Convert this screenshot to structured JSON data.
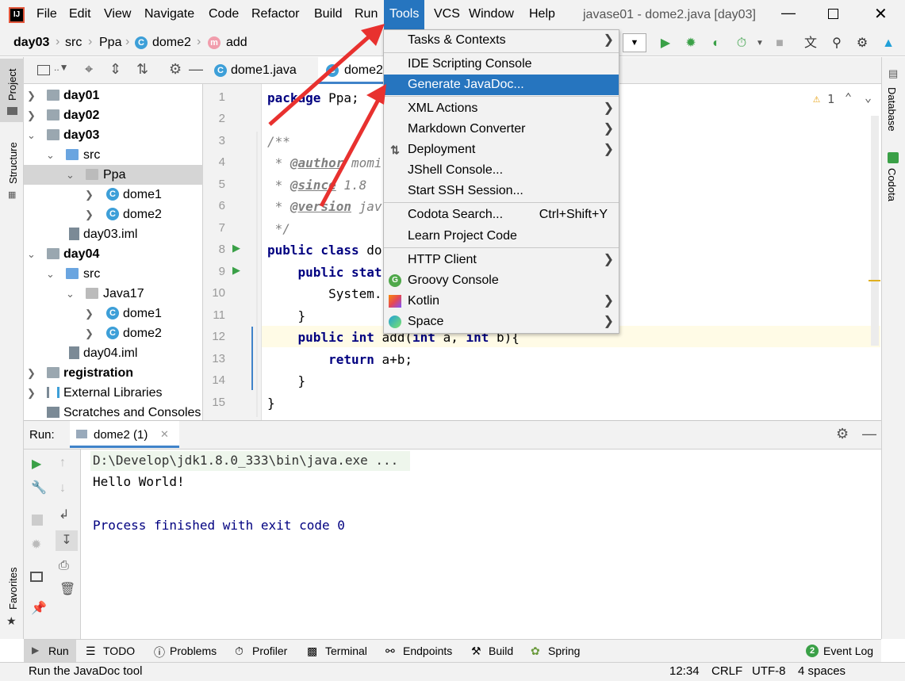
{
  "menubar": {
    "items": [
      "File",
      "Edit",
      "View",
      "Navigate",
      "Code",
      "Refactor",
      "Build",
      "Run",
      "Tools",
      "VCS",
      "Window",
      "Help"
    ],
    "window_title": "javase01 - dome2.java [day03]"
  },
  "breadcrumb": [
    "day03",
    "src",
    "Ppa",
    "dome2",
    "add"
  ],
  "left_strip": {
    "project": "Project",
    "structure": "Structure",
    "favorites": "Favorites"
  },
  "right_strip": {
    "database": "Database",
    "codota": "Codota"
  },
  "tree": [
    {
      "label": "day01",
      "bold": true
    },
    {
      "label": "day02",
      "bold": true
    },
    {
      "label": "day03",
      "bold": true
    },
    {
      "label": "src"
    },
    {
      "label": "Ppa"
    },
    {
      "label": "dome1"
    },
    {
      "label": "dome2"
    },
    {
      "label": "day03.iml"
    },
    {
      "label": "day04",
      "bold": true
    },
    {
      "label": "src"
    },
    {
      "label": "Java17"
    },
    {
      "label": "dome1"
    },
    {
      "label": "dome2"
    },
    {
      "label": "day04.iml"
    },
    {
      "label": "registration",
      "bold": true
    },
    {
      "label": "External Libraries"
    },
    {
      "label": "Scratches and Consoles"
    }
  ],
  "editor": {
    "tabs": [
      "dome1.java",
      "dome2"
    ],
    "warnings": "1",
    "line_numbers": [
      "1",
      "2",
      "3",
      "4",
      "5",
      "6",
      "7",
      "8",
      "9",
      "10",
      "11",
      "12",
      "13",
      "14",
      "15"
    ],
    "code": {
      "l1_kw": "package",
      "l1_rest": " Ppa;",
      "l3": "/**",
      "l4_pre": " * ",
      "l4_tag": "@author",
      "l4_rest": " momi",
      "l5_pre": " * ",
      "l5_tag": "@since",
      "l5_rest": " 1.8",
      "l6_pre": " * ",
      "l6_tag": "@version",
      "l6_rest": " jav",
      "l7": " */",
      "l8_kw": "public class",
      "l8_rest": " do",
      "l9_kw": "    public stat",
      "l10": "        System.",
      "l11": "    }",
      "l12_kw1": "    public int",
      "l12_mid": " add(",
      "l12_kw2": "int",
      "l12_mid2": " a, ",
      "l12_kw3": "int",
      "l12_end": " b){",
      "l13_kw": "        return",
      "l13_rest": " a+b;",
      "l14": "    }",
      "l15": "}"
    }
  },
  "tools_menu": [
    {
      "label": "Tasks & Contexts",
      "submenu": true
    },
    {
      "label": "IDE Scripting Console"
    },
    {
      "label": "Generate JavaDoc...",
      "highlighted": true
    },
    {
      "label": "XML Actions",
      "submenu": true
    },
    {
      "label": "Markdown Converter",
      "submenu": true
    },
    {
      "label": "Deployment",
      "submenu": true
    },
    {
      "label": "JShell Console..."
    },
    {
      "label": "Start SSH Session..."
    },
    {
      "label": "Codota Search...",
      "shortcut": "Ctrl+Shift+Y"
    },
    {
      "label": "Learn Project Code"
    },
    {
      "label": "HTTP Client",
      "submenu": true
    },
    {
      "label": "Groovy Console"
    },
    {
      "label": "Kotlin",
      "submenu": true
    },
    {
      "label": "Space",
      "submenu": true
    }
  ],
  "run": {
    "label": "Run:",
    "tab": "dome2 (1)",
    "output": [
      "D:\\Develop\\jdk1.8.0_333\\bin\\java.exe ...",
      "Hello World!",
      "",
      "Process finished with exit code 0"
    ]
  },
  "bottom_tabs": [
    "Run",
    "TODO",
    "Problems",
    "Profiler",
    "Terminal",
    "Endpoints",
    "Build",
    "Spring"
  ],
  "event_log": {
    "count": "2",
    "label": "Event Log"
  },
  "status": {
    "message": "Run the JavaDoc tool",
    "position": "12:34",
    "line_sep": "CRLF",
    "encoding": "UTF-8",
    "indent": "4 spaces"
  },
  "colors": {
    "accent": "#2675bf",
    "arrow": "#e8312f",
    "keyword": "#000080"
  }
}
